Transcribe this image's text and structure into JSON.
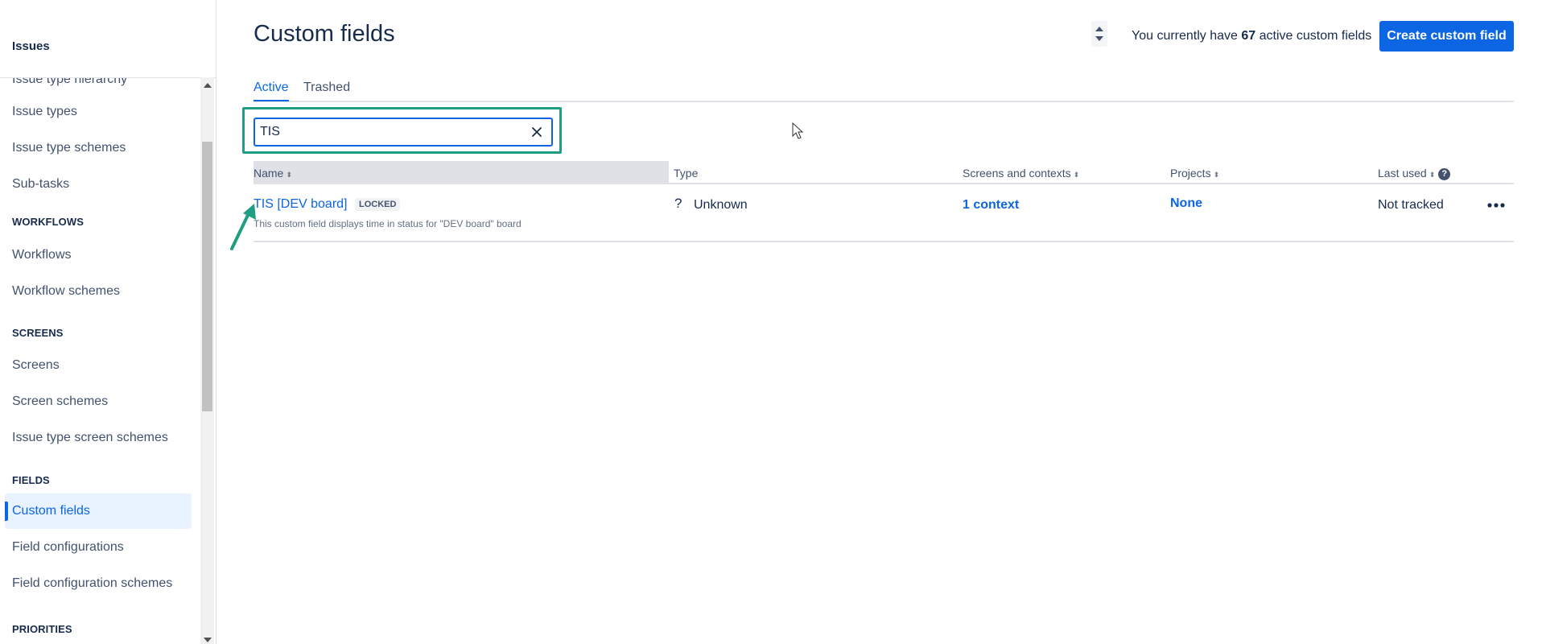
{
  "sidebar": {
    "section_title": "Issues",
    "partial_item": "Issue type hierarchy",
    "items": [
      {
        "label": "Issue types"
      },
      {
        "label": "Issue type schemes"
      },
      {
        "label": "Sub-tasks"
      },
      {
        "group": "WORKFLOWS"
      },
      {
        "label": "Workflows"
      },
      {
        "label": "Workflow schemes"
      },
      {
        "group": "SCREENS"
      },
      {
        "label": "Screens"
      },
      {
        "label": "Screen schemes"
      },
      {
        "label": "Issue type screen schemes"
      },
      {
        "group": "FIELDS"
      },
      {
        "label": "Custom fields",
        "active": true
      },
      {
        "label": "Field configurations"
      },
      {
        "label": "Field configuration schemes"
      },
      {
        "group": "PRIORITIES"
      }
    ]
  },
  "header": {
    "title": "Custom fields",
    "count_prefix": "You currently have",
    "count_value": "67",
    "count_suffix": "active custom fields",
    "create_label": "Create custom field"
  },
  "tabs": [
    {
      "label": "Active",
      "active": true
    },
    {
      "label": "Trashed",
      "active": false
    }
  ],
  "search": {
    "value": "TIS"
  },
  "table": {
    "columns": [
      "Name",
      "Type",
      "Screens and contexts",
      "Projects",
      "Last used"
    ],
    "rows": [
      {
        "name": "TIS [DEV board]",
        "badge": "LOCKED",
        "description": "This custom field displays time in status for \"DEV board\" board",
        "type": "Unknown",
        "contexts": "1 context",
        "projects": "None",
        "last_used": "Not tracked"
      }
    ]
  },
  "colors": {
    "accent": "#0c66e4",
    "annotation": "#1f9e83",
    "text": "#172b4d"
  }
}
